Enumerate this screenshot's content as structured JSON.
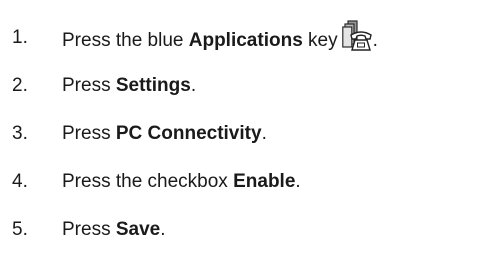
{
  "steps": [
    {
      "number": "1.",
      "before": "Press the blue ",
      "bold": "Applications",
      "after": " key",
      "icon": "applications-key-icon",
      "end": "."
    },
    {
      "number": "2.",
      "before": "Press ",
      "bold": "Settings",
      "after": "."
    },
    {
      "number": "3.",
      "before": "Press ",
      "bold": "PC Connectivity",
      "after": "."
    },
    {
      "number": "4.",
      "before": "Press the checkbox ",
      "bold": "Enable",
      "after": "."
    },
    {
      "number": "5.",
      "before": "Press ",
      "bold": "Save",
      "after": "."
    }
  ]
}
